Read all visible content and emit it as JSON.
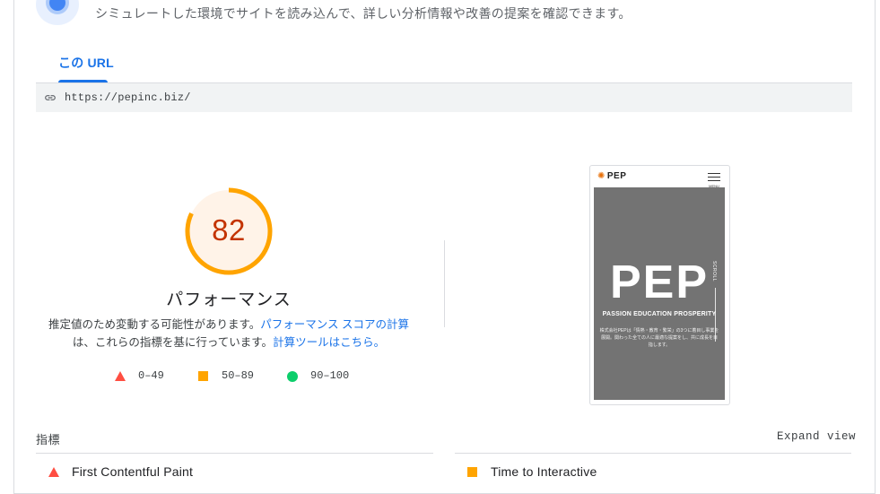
{
  "header": {
    "intro_text": "シミュレートした環境でサイトを読み込んで、詳しい分析情報や改善の提案を確認できます。"
  },
  "tabs": [
    {
      "label": "この URL",
      "active": true
    }
  ],
  "url_bar": {
    "icon": "link-icon",
    "url": "https://pepinc.biz/"
  },
  "performance": {
    "score": "82",
    "score_value": 82,
    "score_color": "#c33300",
    "arc_color": "#ffa400",
    "title": "パフォーマンス",
    "description": {
      "part1": "推定値のため変動する可能性があります。",
      "link1": "パフォーマンス スコアの計算",
      "part2": "は、これらの指標を基に行っています。",
      "link2": "計算ツールはこちら。"
    },
    "legend": [
      {
        "shape": "triangle",
        "color": "#ff4e42",
        "label": "0–49"
      },
      {
        "shape": "square",
        "color": "#ffa400",
        "label": "50–89"
      },
      {
        "shape": "circle",
        "color": "#0cce6b",
        "label": "90–100"
      }
    ]
  },
  "screenshot": {
    "logo_text": "PEP",
    "menu_label": "MENU",
    "hero_title": "PEP",
    "hero_subtitle": "PASSION EDUCATION PROSPERITY",
    "hero_body": "株式会社PEPは「情熱・教育・繁栄」の3つに着目し事業を展開。関わった全ての人に最適な提案をし、共に成長を目指します。",
    "scroll_label": "SCROLL"
  },
  "metrics": {
    "title": "指標",
    "expand_label": "Expand view",
    "items": [
      {
        "name": "First Contentful Paint",
        "rating": "fail",
        "color": "#ff4e42"
      },
      {
        "name": "Time to Interactive",
        "rating": "average",
        "color": "#ffa400"
      }
    ]
  }
}
